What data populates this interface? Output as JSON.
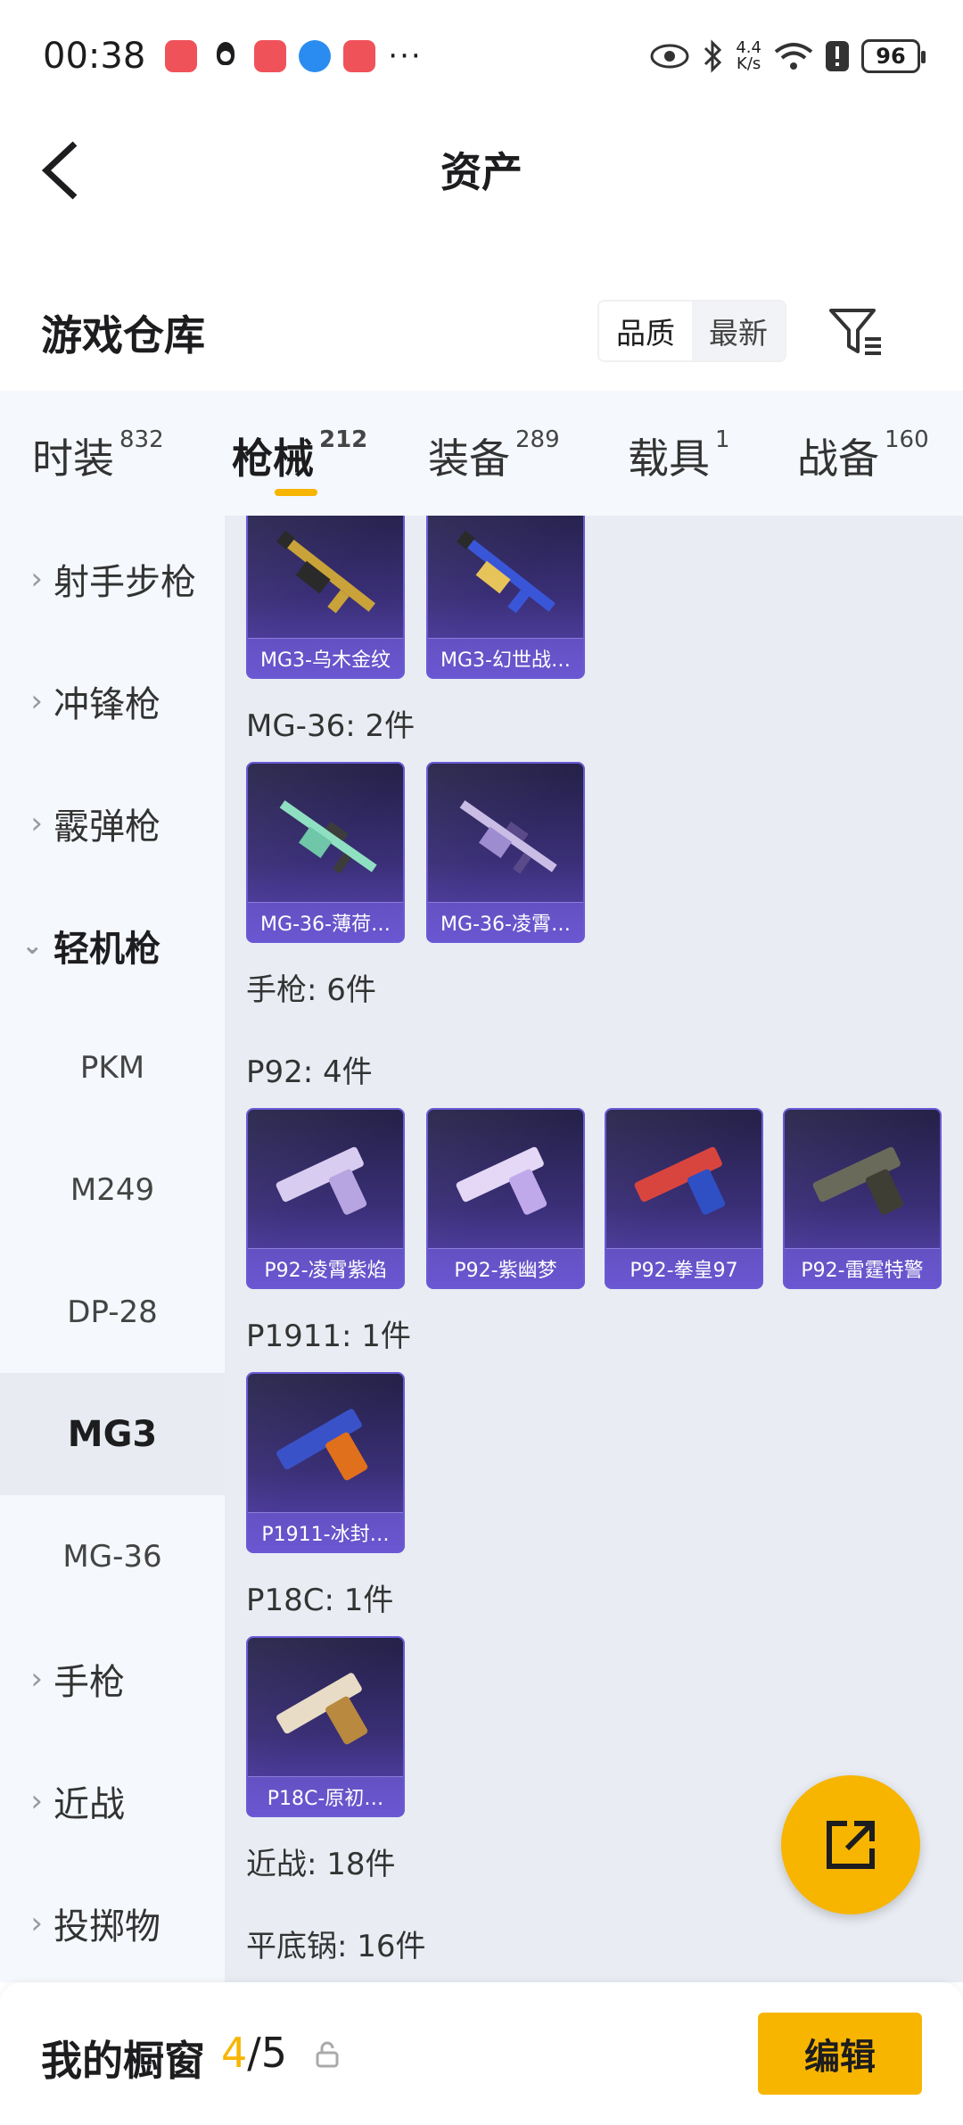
{
  "status": {
    "time": "00:38",
    "more": "···",
    "speed_value": "4.4",
    "speed_unit": "K/s",
    "battery": "96"
  },
  "header": {
    "title": "资产"
  },
  "warehouse": {
    "title": "游戏仓库",
    "sort_quality": "品质",
    "sort_newest": "最新"
  },
  "tabs": [
    {
      "label": "时装",
      "count": "832"
    },
    {
      "label": "枪械",
      "count": "212"
    },
    {
      "label": "装备",
      "count": "289"
    },
    {
      "label": "载具",
      "count": "1"
    },
    {
      "label": "战备",
      "count": "160"
    }
  ],
  "sidebar": {
    "categories": [
      "射手步枪",
      "冲锋枪",
      "霰弹枪",
      "轻机枪",
      "手枪",
      "近战",
      "投掷物"
    ],
    "subs": [
      "PKM",
      "M249",
      "DP-28",
      "MG3",
      "MG-36"
    ]
  },
  "content": {
    "groups": [
      "MG-36: 2件",
      "手枪: 6件",
      "P92: 4件",
      "P1911: 1件",
      "P18C: 1件",
      "近战: 18件",
      "平底锅: 16件"
    ],
    "cards": [
      "MG3-乌木金纹",
      "MG3-幻世战…",
      "MG-36-薄荷…",
      "MG-36-凌霄…",
      "P92-凌霄紫焰",
      "P92-紫幽梦",
      "P92-拳皇97",
      "P92-雷霆特警",
      "P1911-冰封…",
      "P18C-原初…"
    ]
  },
  "bottom": {
    "title": "我的橱窗",
    "current": "4",
    "total": "/5",
    "edit": "编辑"
  },
  "colors": {
    "accent": "#f7b500",
    "card_bg": "#3a2f77",
    "panel_bg": "#e9edf3"
  }
}
